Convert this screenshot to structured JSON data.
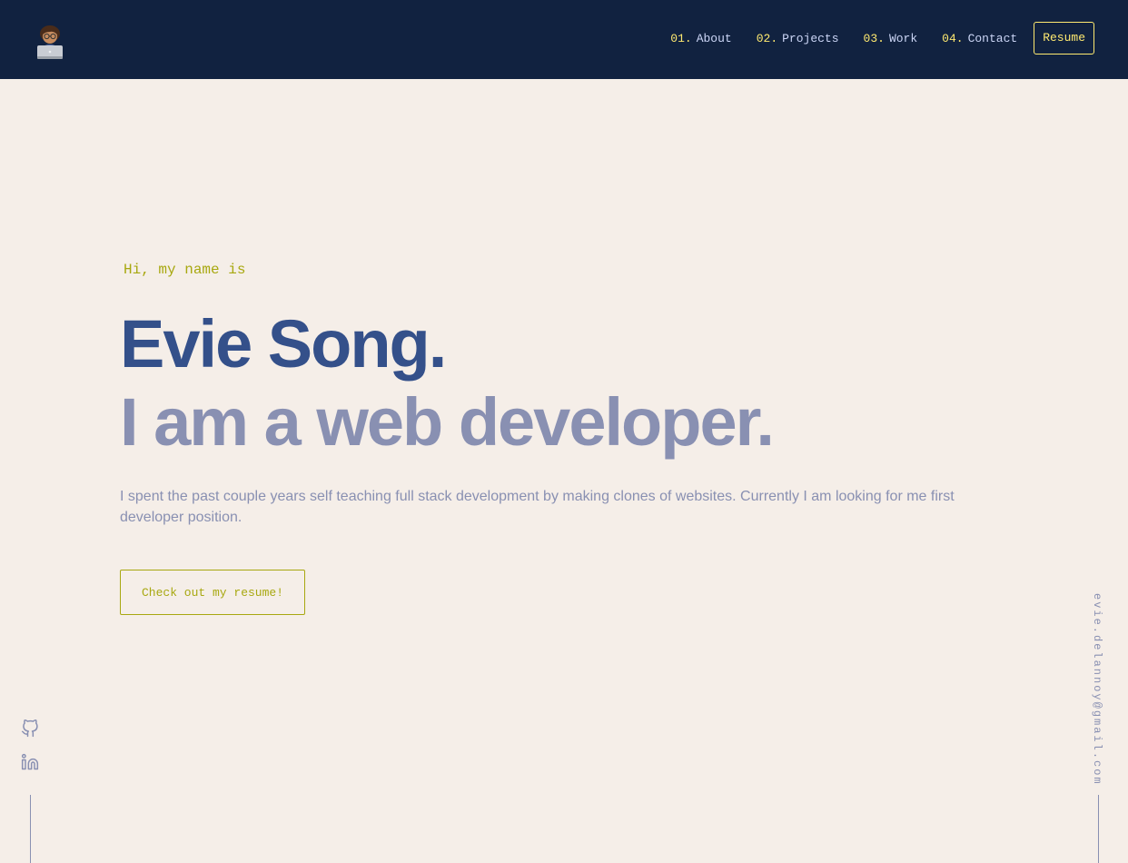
{
  "header": {
    "logo_icon": "technologist-with-laptop-emoji",
    "nav": [
      {
        "num": "01.",
        "label": "About"
      },
      {
        "num": "02.",
        "label": "Projects"
      },
      {
        "num": "03.",
        "label": "Work"
      },
      {
        "num": "04.",
        "label": "Contact"
      }
    ],
    "resume_label": "Resume"
  },
  "hero": {
    "greeting": "Hi, my name is",
    "name": "Evie Song.",
    "tagline": "I am a web developer.",
    "bio": "I spent the past couple years self teaching full stack development by making clones of websites. Currently I am looking for me first developer position.",
    "cta_label": "Check out my resume!"
  },
  "sidebar_left": {
    "icons": [
      "github-icon",
      "linkedin-icon"
    ]
  },
  "sidebar_right": {
    "email": "evie.delannoy@gmail.com"
  },
  "colors": {
    "navy": "#112240",
    "background": "#f5eee8",
    "accent": "#ffea70",
    "accent_dark": "#a8a810",
    "name": "#34508a",
    "slate": "#8990b2",
    "nav_text": "#ccd6f6"
  }
}
